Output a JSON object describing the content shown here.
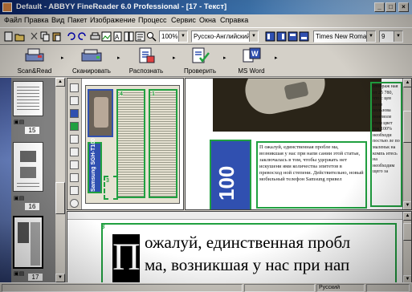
{
  "window": {
    "title": "Default - ABBYY FineReader 6.0 Professional - [17 - Текст]",
    "controls": [
      "_",
      "□",
      "×"
    ]
  },
  "menu": {
    "items": [
      "Файл",
      "Правка",
      "Вид",
      "Пакет",
      "Изображение",
      "Процесс",
      "Сервис",
      "Окна",
      "Справка"
    ]
  },
  "toolbar": {
    "zoom": "100%",
    "language": "Русско-Английский",
    "font": "Times New Roman",
    "font_size": "9"
  },
  "big_toolbar": {
    "scan_read": "Scan&Read",
    "scan": "Сканировать",
    "recognize": "Распознать",
    "check": "Проверить",
    "ms_word": "MS Word"
  },
  "thumbnails": {
    "pages": [
      "15",
      "16",
      "17"
    ]
  },
  "image_pane": {
    "vertical_text": "Samsung SGH-T100",
    "block_numbers": [
      "4",
      "1",
      "3"
    ]
  },
  "zoom_pane": {
    "big_label": "100",
    "article_text": "П ожалуй, единственная пробле ма, возникшая у нас при напи сании этой статьи, заключалась в том, чтобы удержать нет искушени ями количества эпитетов в превосход ной степени. Действительно, новый мобильный телефон Samsung привел",
    "side_text": "отображ ная от 25 780, что с цев мене пользова поневоле стем цвет ток 100% необходи постью ле по маленьк на компь итесь на необходим щего за"
  },
  "text_pane": {
    "block_number": "3",
    "drop_cap": "П",
    "line1": "ожалуй, единственная пробл",
    "line2": "ма, возникшая у нас при нап"
  },
  "status": {
    "language": "Русский"
  },
  "colors": {
    "titlebar_start": "#0a246a",
    "titlebar_end": "#a6caf0",
    "window_face": "#d4d0c8",
    "block_blue": "#3050b0",
    "block_green": "#20a040"
  }
}
